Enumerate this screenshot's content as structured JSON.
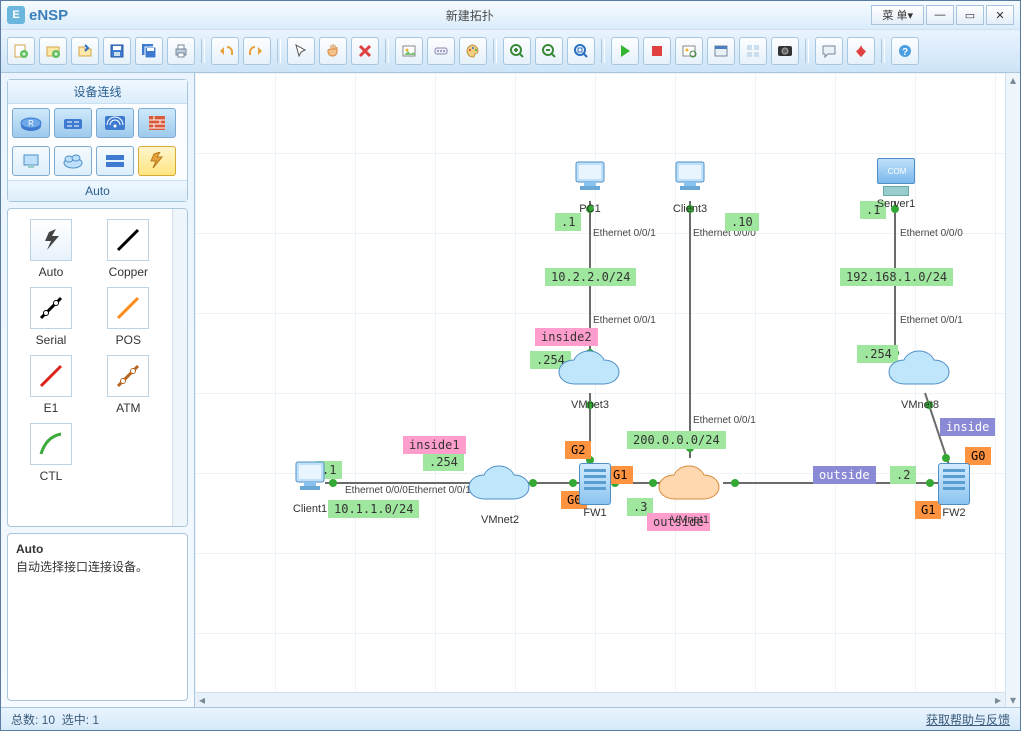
{
  "app": {
    "logo": "eNSP",
    "title": "新建拓扑",
    "menu": "菜 单"
  },
  "side": {
    "hd": "设备连线",
    "sub": "Auto"
  },
  "conn": [
    {
      "k": "auto",
      "label": "Auto",
      "color": "#333",
      "bolt": true
    },
    {
      "k": "copper",
      "label": "Copper",
      "color": "#000"
    },
    {
      "k": "serial",
      "label": "Serial",
      "color": "#000",
      "dash": true
    },
    {
      "k": "pos",
      "label": "POS",
      "color": "#ff8c1a"
    },
    {
      "k": "e1",
      "label": "E1",
      "color": "#d9261c"
    },
    {
      "k": "atm",
      "label": "ATM",
      "color": "#b5651d"
    },
    {
      "k": "ctl",
      "label": "CTL",
      "color": "#3cab3c",
      "curve": true
    }
  ],
  "desc": {
    "title": "Auto",
    "body": "自动选择接口连接设备。"
  },
  "nodes": {
    "client1": "Client1",
    "pc1": "PC1",
    "client3": "Client3",
    "server1": "Server1",
    "vmnet2": "VMnet2",
    "vmnet3": "VMnet3",
    "vmnet1": "VMnet1",
    "vmnet8": "VMnet8",
    "fw1": "FW1",
    "fw2": "FW2"
  },
  "iface": {
    "e000": "Ethernet 0/0/0",
    "e001": "Ethernet 0/0/1"
  },
  "tags": {
    "ip_10_1": "10.1.1.0/24",
    "ip_10_2": "10.2.2.0/24",
    "ip_200": "200.0.0.0/24",
    "ip_192": "192.168.1.0/24",
    "d1": ".1",
    "d10": ".10",
    "d254": ".254",
    "d2": ".2",
    "d3": ".3",
    "inside1": "inside1",
    "inside2": "inside2",
    "inside": "inside",
    "outside": "outside",
    "g0": "G0",
    "g1": "G1",
    "g2": "G2"
  },
  "status": {
    "count": "总数: 10",
    "sel": "选中: 1",
    "help": "获取帮助与反馈"
  }
}
